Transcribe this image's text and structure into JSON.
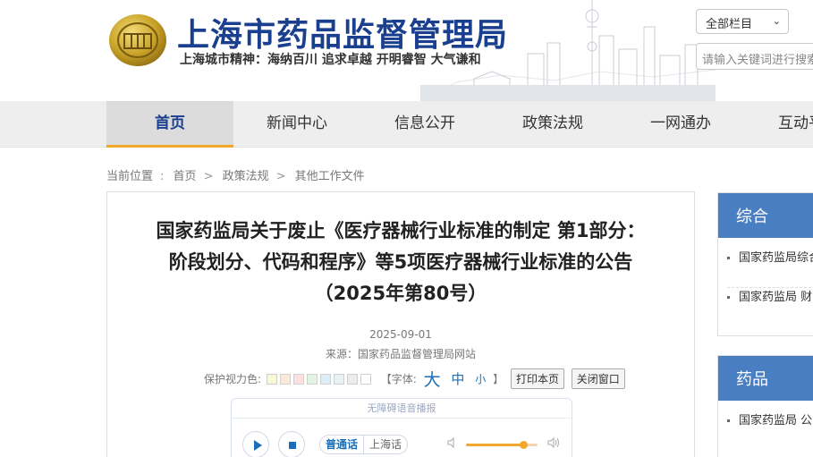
{
  "header": {
    "site_title": "上海市药品监督管理局",
    "site_motto": "上海城市精神：海纳百川  追求卓越  开明睿智  大气谦和",
    "search_scope": "全部栏目",
    "search_placeholder": "请输入关键词进行搜索"
  },
  "nav": {
    "items": [
      {
        "label": "首页"
      },
      {
        "label": "新闻中心"
      },
      {
        "label": "信息公开"
      },
      {
        "label": "政策法规"
      },
      {
        "label": "一网通办"
      },
      {
        "label": "互动平台"
      }
    ],
    "active_index": 0
  },
  "breadcrumb": {
    "label": "当前位置",
    "items": [
      "首页",
      "政策法规",
      "其他工作文件"
    ]
  },
  "article": {
    "title_lines": [
      "国家药监局关于废止《医疗器械行业标准的制定 第1部分：",
      "阶段划分、代码和程序》等5项医疗器械行业标准的公告",
      "（2025年第80号）"
    ],
    "date": "2025-09-01",
    "source": "来源：国家药品监督管理局网站",
    "tools": {
      "eye_care_label": "保护视力色:",
      "eye_care_colors": [
        "#fafad2",
        "#fbe9d9",
        "#fde1e1",
        "#e3f4e3",
        "#ddeefb",
        "#e6f3f0",
        "#ececec",
        "#ffffff"
      ],
      "font_prefix": "【字体:",
      "font_big": "大",
      "font_mid": "中",
      "font_small": "小",
      "font_suffix": "】",
      "print_label": "打印本页",
      "close_label": "关闭窗口"
    }
  },
  "player": {
    "title": "无障碍语音播报",
    "lang_mandarin": "普通话",
    "lang_shanghai": "上海话",
    "volume": 0.8,
    "accent": "#f0a72a",
    "primary": "#1a6fb8"
  },
  "sidebar": [
    {
      "heading": "综合",
      "items": [
        "国家药监局综合",
        "国家药监局 财"
      ]
    },
    {
      "heading": "药品",
      "items": [
        "国家药监局 公"
      ]
    }
  ],
  "colors": {
    "brand_blue": "#1a3f8f",
    "nav_active_underline": "#f0a72a",
    "sidebar_head": "#4a7ec2"
  }
}
